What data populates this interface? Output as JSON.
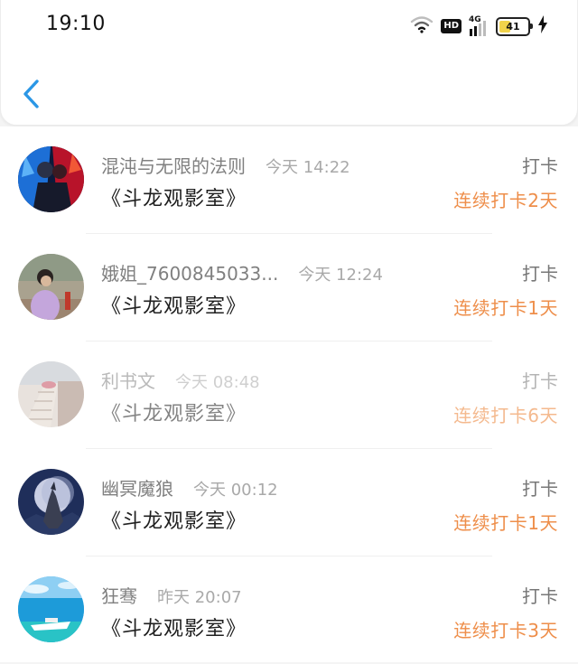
{
  "status_bar": {
    "time": "19:10",
    "network": "4G",
    "hd": "HD",
    "battery": "41",
    "battery_level_percent": 41,
    "battery_color": "#f1d34b",
    "icons": [
      "wifi-icon",
      "hd-icon",
      "signal-4g-icon",
      "battery-icon",
      "charging-icon"
    ]
  },
  "header": {
    "back_icon": "chevron-left-icon",
    "accent_color": "#2b97e6"
  },
  "list": {
    "streak_color": "#ee8e4a",
    "items": [
      {
        "name": "混沌与无限的法则",
        "time": "今天 14:22",
        "title": "《斗龙观影室》",
        "action": "打卡",
        "streak": "连续打卡2天",
        "avatar": "anime-warrior-avatar"
      },
      {
        "name": "娥姐_7600845033...",
        "time": "今天 12:24",
        "title": "《斗龙观影室》",
        "action": "打卡",
        "streak": "连续打卡1天",
        "avatar": "woman-photo-avatar"
      },
      {
        "name": "利书文",
        "time": "今天 08:48",
        "title": "《斗龙观影室》",
        "action": "打卡",
        "streak": "连续打卡6天",
        "avatar": "stairs-photo-avatar"
      },
      {
        "name": "幽冥魔狼",
        "time": "今天 00:12",
        "title": "《斗龙观影室》",
        "action": "打卡",
        "streak": "连续打卡1天",
        "avatar": "wolf-moon-avatar"
      },
      {
        "name": "狂骞",
        "time": "昨天 20:07",
        "title": "《斗龙观影室》",
        "action": "打卡",
        "streak": "连续打卡3天",
        "avatar": "boat-sea-avatar"
      }
    ]
  }
}
